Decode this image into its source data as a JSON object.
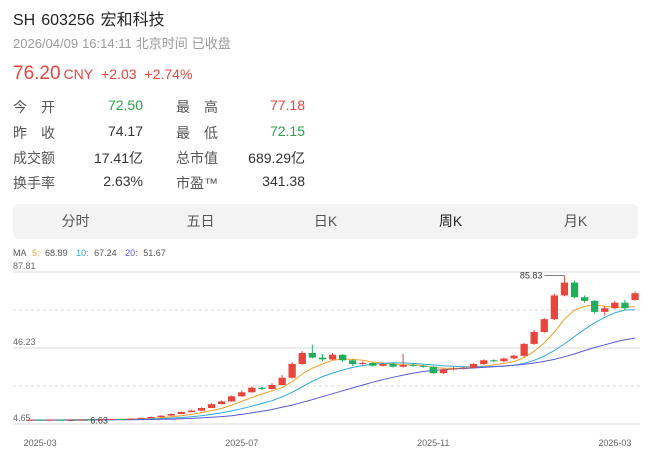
{
  "header": {
    "exchange": "SH",
    "code": "603256",
    "name": "宏和科技",
    "date": "2026/04/09",
    "time": "16:14:11",
    "timezone": "北京时间",
    "status": "已收盘"
  },
  "price": {
    "last": "76.20",
    "currency": "CNY",
    "change": "+2.03",
    "change_pct": "+2.74%"
  },
  "quote": [
    {
      "label": "今　开",
      "value": "72.50",
      "color": "green"
    },
    {
      "label": "最　高",
      "value": "77.18",
      "color": "red"
    },
    {
      "label": "昨　收",
      "value": "74.17",
      "color": "dark"
    },
    {
      "label": "最　低",
      "value": "72.15",
      "color": "green"
    },
    {
      "label": "成交额",
      "value": "17.41亿",
      "color": "dark"
    },
    {
      "label": "总市值",
      "value": "689.29亿",
      "color": "dark"
    },
    {
      "label": "换手率",
      "value": "2.63%",
      "color": "dark"
    },
    {
      "label": "市盈™",
      "value": "341.38",
      "color": "dark"
    }
  ],
  "tabs": [
    "分时",
    "五日",
    "日K",
    "周K",
    "月K"
  ],
  "active_tab": "周K",
  "ma_legend": {
    "title": "MA",
    "ma5_label": "5:",
    "ma5_value": "68.89",
    "ma5_color": "#f0a02a",
    "ma10_label": "10:",
    "ma10_value": "67.24",
    "ma10_color": "#2fa8dc",
    "ma20_label": "20:",
    "ma20_value": "51.67",
    "ma20_color": "#5a5ad6"
  },
  "chart_data": {
    "type": "candlestick",
    "y_ticks": [
      87.81,
      46.23,
      4.65
    ],
    "ylim": [
      4.65,
      87.81
    ],
    "x_ticks": [
      "2025-03",
      "2025-07",
      "2025-11",
      "2026-03"
    ],
    "annotations": [
      {
        "label": "85.83",
        "type": "max"
      },
      {
        "label": "6.63",
        "type": "min"
      }
    ],
    "up_color": "#e8453c",
    "down_color": "#1fae5b",
    "candles": [
      [
        6.8,
        7.0,
        6.9,
        7.2
      ],
      [
        7.0,
        6.9,
        7.2,
        6.8
      ],
      [
        6.9,
        7.0,
        6.8,
        7.1
      ],
      [
        7.0,
        6.8,
        7.1,
        6.7
      ],
      [
        6.8,
        6.9,
        6.7,
        7.0
      ],
      [
        6.9,
        7.1,
        6.8,
        7.2
      ],
      [
        7.1,
        7.0,
        7.2,
        6.9
      ],
      [
        7.0,
        7.2,
        6.9,
        7.3
      ],
      [
        7.2,
        7.4,
        7.1,
        7.5
      ],
      [
        7.4,
        7.3,
        7.5,
        7.2
      ],
      [
        7.3,
        7.6,
        7.2,
        7.7
      ],
      [
        7.6,
        8.0,
        7.5,
        8.2
      ],
      [
        8.0,
        8.5,
        7.9,
        8.7
      ],
      [
        8.5,
        9.2,
        8.4,
        9.4
      ],
      [
        9.2,
        10.1,
        9.0,
        10.4
      ],
      [
        10.1,
        11.2,
        10.0,
        11.6
      ],
      [
        11.2,
        12.0,
        11.0,
        12.4
      ],
      [
        12.0,
        13.4,
        11.8,
        13.8
      ],
      [
        13.4,
        15.5,
        13.2,
        16.0
      ],
      [
        15.5,
        17.0,
        15.3,
        17.5
      ],
      [
        17.0,
        19.8,
        16.8,
        20.3
      ],
      [
        19.8,
        22.0,
        19.5,
        23.0
      ],
      [
        22.0,
        24.5,
        21.8,
        25.2
      ],
      [
        24.5,
        23.8,
        25.0,
        23.2
      ],
      [
        23.8,
        26.0,
        23.5,
        27.0
      ],
      [
        26.0,
        30.0,
        25.8,
        31.5
      ],
      [
        30.0,
        37.5,
        29.5,
        38.5
      ],
      [
        37.5,
        43.5,
        37.0,
        44.5
      ],
      [
        43.5,
        41.0,
        48.0,
        40.5
      ],
      [
        41.0,
        40.0,
        43.0,
        39.0
      ],
      [
        40.0,
        42.5,
        39.5,
        43.5
      ],
      [
        42.5,
        39.5,
        43.0,
        38.5
      ],
      [
        39.5,
        37.5,
        40.0,
        36.5
      ],
      [
        37.5,
        38.0,
        37.0,
        39.0
      ],
      [
        38.0,
        36.5,
        38.5,
        36.0
      ],
      [
        36.5,
        37.5,
        36.0,
        38.0
      ],
      [
        37.5,
        36.0,
        38.0,
        35.5
      ],
      [
        36.0,
        37.0,
        35.5,
        43.0
      ],
      [
        37.0,
        36.5,
        38.0,
        36.0
      ],
      [
        36.5,
        36.0,
        37.0,
        35.5
      ],
      [
        36.0,
        32.5,
        36.5,
        32.0
      ],
      [
        32.5,
        34.5,
        32.0,
        35.0
      ],
      [
        34.5,
        35.0,
        34.0,
        35.8
      ],
      [
        35.0,
        35.5,
        34.5,
        36.0
      ],
      [
        35.5,
        37.5,
        35.0,
        38.0
      ],
      [
        37.5,
        39.5,
        37.0,
        40.0
      ],
      [
        39.5,
        39.0,
        40.0,
        38.5
      ],
      [
        39.0,
        40.5,
        38.5,
        41.0
      ],
      [
        40.5,
        42.0,
        40.0,
        42.5
      ],
      [
        42.0,
        48.5,
        41.5,
        49.0
      ],
      [
        48.5,
        55.0,
        48.0,
        56.0
      ],
      [
        55.0,
        62.0,
        54.5,
        62.5
      ],
      [
        62.0,
        75.0,
        61.5,
        76.0
      ],
      [
        75.0,
        82.0,
        74.5,
        85.83
      ],
      [
        82.0,
        74.0,
        83.0,
        73.5
      ],
      [
        74.0,
        72.0,
        75.0,
        71.0
      ],
      [
        72.0,
        66.0,
        72.5,
        65.0
      ],
      [
        66.0,
        68.0,
        64.0,
        69.0
      ],
      [
        68.0,
        71.0,
        67.5,
        72.0
      ],
      [
        71.0,
        68.0,
        72.5,
        67.0
      ],
      [
        72.5,
        76.2,
        72.15,
        77.18
      ]
    ],
    "series": [
      {
        "name": "5",
        "values": [
          6.8,
          6.85,
          6.9,
          6.9,
          6.9,
          6.95,
          7.0,
          7.05,
          7.1,
          7.2,
          7.3,
          7.5,
          7.7,
          8.1,
          8.6,
          9.2,
          9.9,
          10.8,
          12.0,
          13.2,
          15.0,
          17.0,
          19.2,
          21.0,
          22.8,
          24.5,
          27.8,
          32.0,
          35.2,
          37.5,
          39.5,
          40.2,
          40.0,
          39.5,
          38.5,
          38.0,
          37.5,
          37.0,
          37.0,
          36.6,
          35.6,
          35.2,
          35.2,
          35.2,
          35.6,
          36.2,
          37.0,
          37.8,
          38.8,
          41.0,
          44.5,
          49.0,
          55.0,
          62.0,
          67.0,
          69.0,
          70.0,
          69.0,
          68.5,
          68.5,
          68.89
        ]
      },
      {
        "name": "10",
        "values": [
          6.8,
          6.8,
          6.85,
          6.85,
          6.9,
          6.9,
          6.95,
          7.0,
          7.0,
          7.1,
          7.15,
          7.25,
          7.4,
          7.6,
          7.9,
          8.2,
          8.6,
          9.2,
          9.9,
          10.8,
          11.8,
          13.0,
          14.4,
          15.9,
          17.4,
          19.5,
          22.0,
          25.0,
          28.0,
          30.6,
          32.5,
          34.2,
          35.6,
          36.6,
          37.3,
          37.8,
          38.2,
          38.0,
          37.8,
          37.4,
          37.0,
          36.5,
          36.2,
          36.0,
          36.0,
          36.0,
          36.1,
          36.3,
          36.8,
          37.8,
          39.5,
          41.8,
          44.8,
          48.5,
          52.5,
          56.5,
          60.0,
          63.0,
          65.5,
          67.0,
          67.24
        ]
      },
      {
        "name": "20",
        "values": [
          6.8,
          6.8,
          6.8,
          6.8,
          6.85,
          6.85,
          6.9,
          6.9,
          6.95,
          6.95,
          7.0,
          7.05,
          7.1,
          7.2,
          7.3,
          7.5,
          7.7,
          8.0,
          8.3,
          8.7,
          9.2,
          9.9,
          10.7,
          11.6,
          12.6,
          13.8,
          15.0,
          16.5,
          18.0,
          19.6,
          21.2,
          22.8,
          24.4,
          26.0,
          27.5,
          28.9,
          30.2,
          31.4,
          32.5,
          33.4,
          34.0,
          34.4,
          34.8,
          35.0,
          35.3,
          35.6,
          36.0,
          36.4,
          36.8,
          37.3,
          38.0,
          38.9,
          40.0,
          41.4,
          43.0,
          44.8,
          46.5,
          48.0,
          49.5,
          50.7,
          51.67
        ]
      }
    ]
  }
}
